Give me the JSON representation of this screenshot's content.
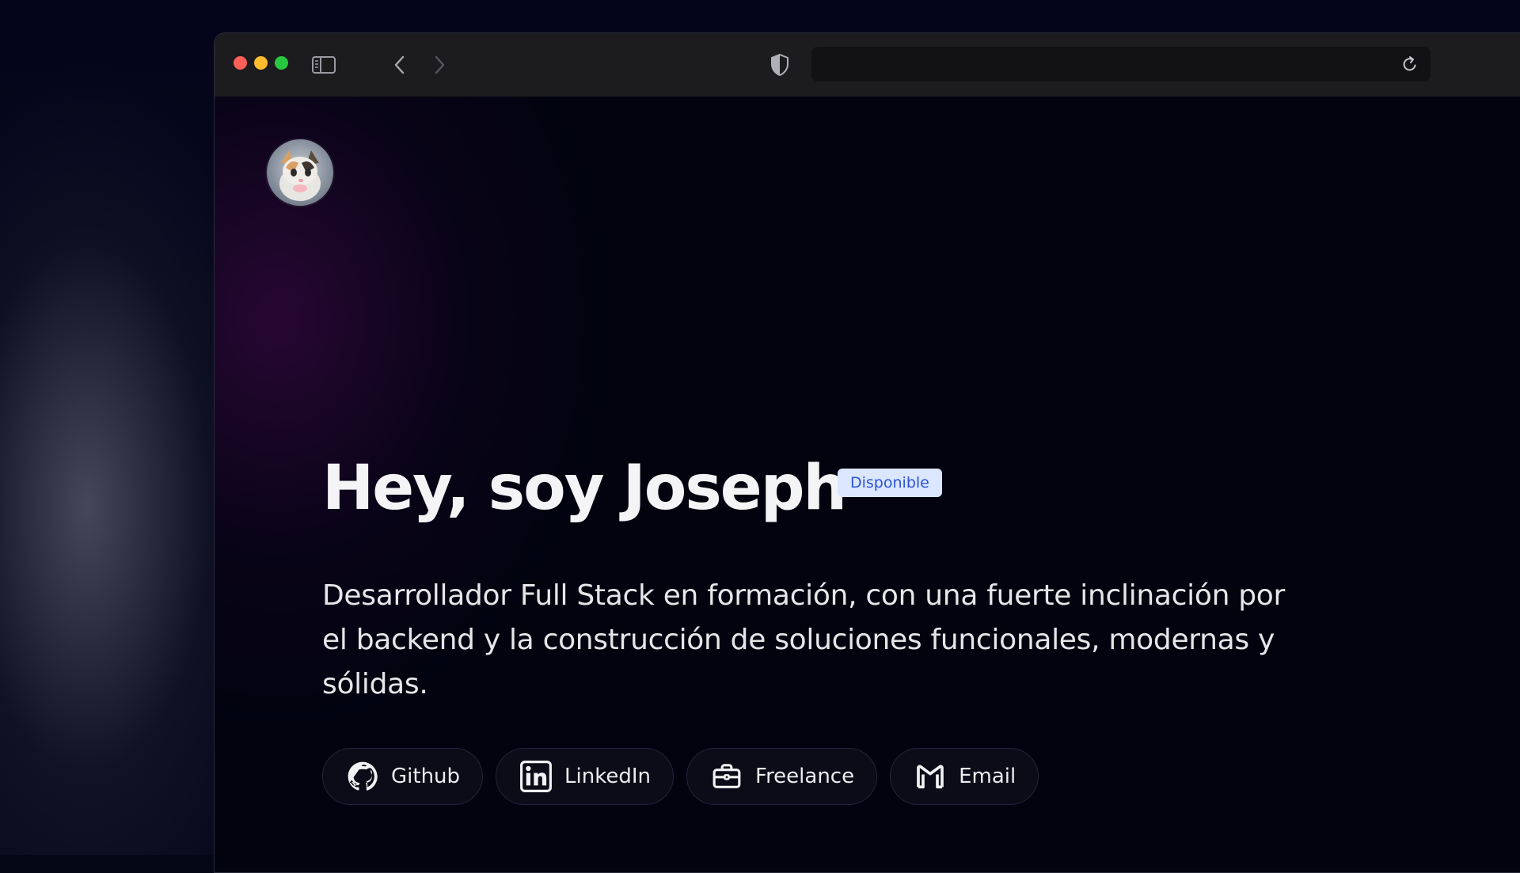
{
  "browser": {
    "address": "",
    "icons": {
      "sidebar": "sidebar-toggle-icon",
      "back": "chevron-left-icon",
      "forward": "chevron-right-icon",
      "privacy": "shield-icon",
      "reload": "reload-icon"
    },
    "traffic_colors": {
      "close": "#ff5f57",
      "minimize": "#febc2e",
      "zoom": "#28c840"
    }
  },
  "profile": {
    "avatar_icon": "cat-avatar"
  },
  "hero": {
    "title": "Hey, soy Joseph",
    "badge": "Disponible",
    "description": "Desarrollador Full Stack en formación, con una fuerte inclinación por el backend y la construcción de soluciones funcionales, modernas y sólidas."
  },
  "links": [
    {
      "label": "Github",
      "icon": "github-icon"
    },
    {
      "label": "LinkedIn",
      "icon": "linkedin-icon"
    },
    {
      "label": "Freelance",
      "icon": "briefcase-icon"
    },
    {
      "label": "Email",
      "icon": "gmail-icon"
    }
  ],
  "colors": {
    "background": "#02030f",
    "accent_glow": "#46104f",
    "badge_bg": "#dbe6ff",
    "badge_text": "#2c54d6",
    "text": "#f4f4f6"
  }
}
